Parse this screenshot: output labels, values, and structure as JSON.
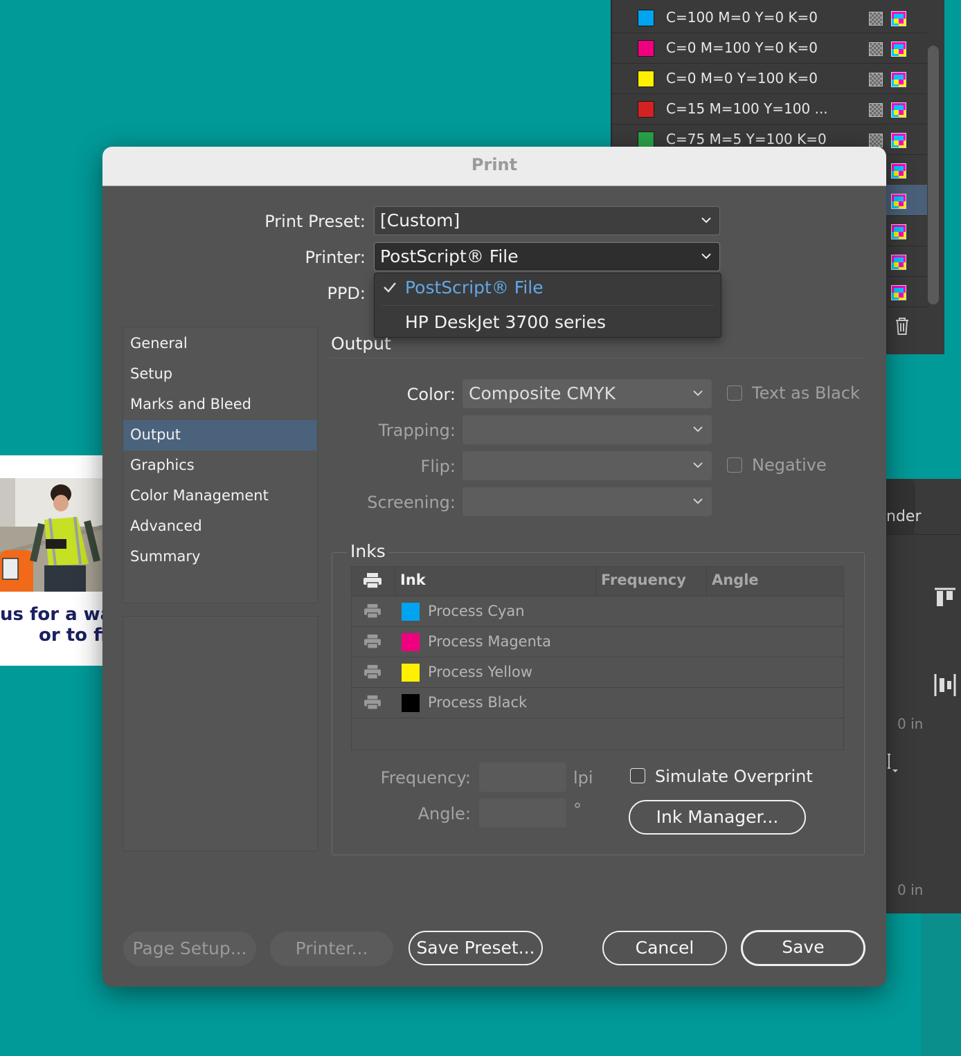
{
  "swatches": [
    {
      "name": "C=100 M=0 Y=0 K=0",
      "color": "#00a4f0"
    },
    {
      "name": "C=0 M=100 Y=0 K=0",
      "color": "#f0007f"
    },
    {
      "name": "C=0 M=0 Y=100 K=0",
      "color": "#fff000"
    },
    {
      "name": "C=15 M=100 Y=100 ...",
      "color": "#d42222"
    },
    {
      "name": "C=75 M=5 Y=100 K=0",
      "color": "#2aa34a"
    }
  ],
  "properties_panel": {
    "tab_label": "nder",
    "value_1": "0 in",
    "value_2": "0 in"
  },
  "document": {
    "line_1": "us for a wat",
    "line_2": "or to fi"
  },
  "dialog": {
    "title": "Print",
    "print_preset_label": "Print Preset:",
    "print_preset_value": "[Custom]",
    "printer_label": "Printer:",
    "printer_value": "PostScript® File",
    "ppd_label": "PPD:",
    "printer_menu": [
      {
        "label": "PostScript® File",
        "checked": true
      },
      {
        "label": "HP DeskJet 3700 series",
        "checked": false
      }
    ],
    "sidebar": [
      "General",
      "Setup",
      "Marks and Bleed",
      "Output",
      "Graphics",
      "Color Management",
      "Advanced",
      "Summary"
    ],
    "active_section": "Output",
    "section_title": "Output",
    "color_label": "Color:",
    "color_value": "Composite CMYK",
    "trapping_label": "Trapping:",
    "trapping_value": "",
    "flip_label": "Flip:",
    "flip_value": "",
    "screening_label": "Screening:",
    "screening_value": "",
    "text_as_black_label": "Text as Black",
    "negative_label": "Negative",
    "inks_title": "Inks",
    "ink_columns": [
      "Ink",
      "Frequency",
      "Angle"
    ],
    "inks": [
      {
        "name": "Process Cyan",
        "color": "#00a4f0"
      },
      {
        "name": "Process Magenta",
        "color": "#f0007f"
      },
      {
        "name": "Process Yellow",
        "color": "#fff000"
      },
      {
        "name": "Process Black",
        "color": "#000000"
      }
    ],
    "frequency_label": "Frequency:",
    "frequency_value": "",
    "frequency_unit": "lpi",
    "angle_label": "Angle:",
    "angle_value": "",
    "angle_unit": "°",
    "simulate_overprint_label": "Simulate Overprint",
    "ink_manager_button": "Ink Manager...",
    "page_setup_button": "Page Setup...",
    "printer_button": "Printer...",
    "save_preset_button": "Save Preset...",
    "cancel_button": "Cancel",
    "save_button": "Save"
  }
}
